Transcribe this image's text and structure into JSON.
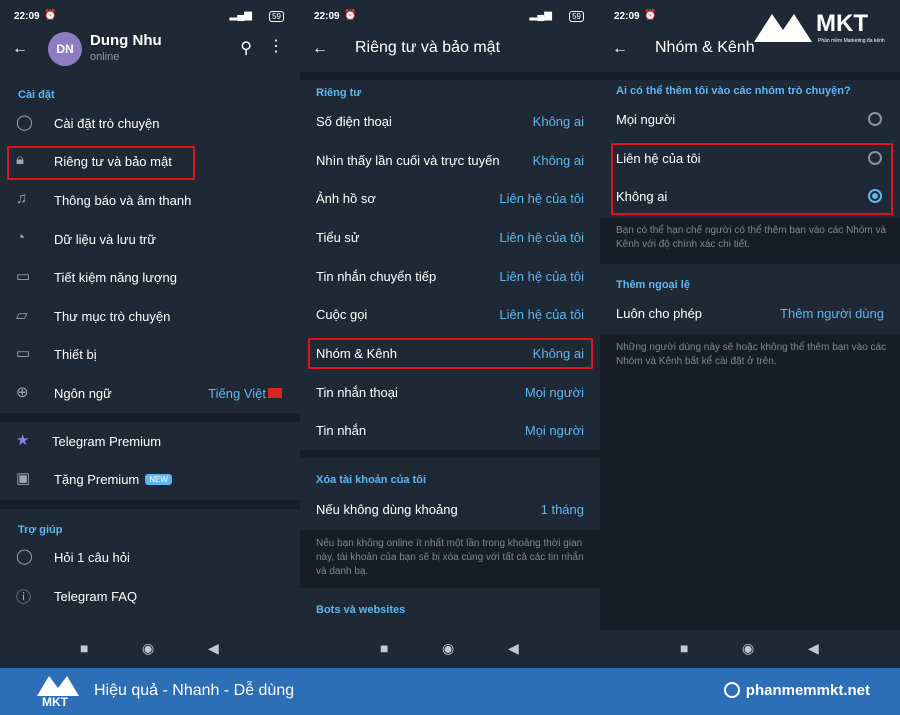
{
  "p1": {
    "time": "22:09",
    "battery": "59",
    "profile_name": "Dung Nhu",
    "profile_status": "online",
    "avatar_initials": "DN",
    "section_settings": "Cài đặt",
    "items": [
      {
        "label": "Cài đặt trò chuyện",
        "icon": "chat-bubble-icon"
      },
      {
        "label": "Riêng tư và bảo mật",
        "icon": "lock-icon"
      },
      {
        "label": "Thông báo và âm thanh",
        "icon": "bell-icon"
      },
      {
        "label": "Dữ liệu và lưu trữ",
        "icon": "clock-icon"
      },
      {
        "label": "Tiết kiệm năng lượng",
        "icon": "battery-icon"
      },
      {
        "label": "Thư mục trò chuyện",
        "icon": "folder-icon"
      },
      {
        "label": "Thiết bị",
        "icon": "devices-icon"
      },
      {
        "label": "Ngôn ngữ",
        "value": "Tiếng Việt",
        "icon": "globe-icon"
      }
    ],
    "premium": "Telegram Premium",
    "gift": "Tặng Premium",
    "gift_badge": "NEW",
    "section_help": "Trợ giúp",
    "help_items": [
      "Hỏi 1 câu hỏi",
      "Telegram FAQ"
    ]
  },
  "p2": {
    "time": "22:09",
    "battery": "59",
    "title": "Riêng tư và bảo mật",
    "section_privacy": "Riêng tư",
    "rows": [
      {
        "label": "Số điện thoại",
        "value": "Không ai"
      },
      {
        "label": "Nhìn thấy lần cuối và trực tuyến",
        "value": "Không ai"
      },
      {
        "label": "Ảnh hồ sơ",
        "value": "Liên hệ của tôi"
      },
      {
        "label": "Tiểu sử",
        "value": "Liên hệ của tôi"
      },
      {
        "label": "Tin nhắn chuyển tiếp",
        "value": "Liên hệ của tôi"
      },
      {
        "label": "Cuộc gọi",
        "value": "Liên hệ của tôi"
      },
      {
        "label": "Nhóm & Kênh",
        "value": "Không ai"
      },
      {
        "label": "Tin nhắn thoại",
        "value": "Mọi người"
      },
      {
        "label": "Tin nhắn",
        "value": "Mọi người"
      }
    ],
    "section_delete": "Xóa tài khoản của tôi",
    "delete_label": "Nếu không dùng khoảng",
    "delete_value": "1 tháng",
    "delete_note": "Nếu bạn không online ít nhất một lần trong khoảng thời gian này, tài khoản của bạn sẽ bị xóa cùng với tất cả các tin nhắn và danh bạ.",
    "section_bots": "Bots và websites"
  },
  "p3": {
    "time": "22:09",
    "title": "Nhóm & Kênh",
    "question": "Ai có thể thêm tôi vào các nhóm trò chuyện?",
    "options": [
      {
        "label": "Mọi người",
        "selected": false
      },
      {
        "label": "Liên hệ của tôi",
        "selected": false
      },
      {
        "label": "Không ai",
        "selected": true
      }
    ],
    "note1": "Bạn có thể hạn chế người có thể thêm bạn vào các Nhóm và Kênh với độ chính xác chi tiết.",
    "section_exceptions": "Thêm ngoại lệ",
    "always_allow": "Luôn cho phép",
    "add_users": "Thêm người dùng",
    "note2": "Những người dùng này sẽ hoặc không thể thêm bạn vào các Nhóm và Kênh bất kể cài đặt ở trên."
  },
  "brand": {
    "logo_text": "MKT",
    "logo_sub": "Phần mềm Marketing đa kênh",
    "slogan": "Hiệu quả - Nhanh - Dễ dùng",
    "site": "phanmemmkt.net"
  },
  "colors": {
    "accent": "#5eb6f0",
    "highlight": "#e0121a",
    "panel_bg": "#1f2936",
    "footer_bg": "#2c6fb6"
  }
}
